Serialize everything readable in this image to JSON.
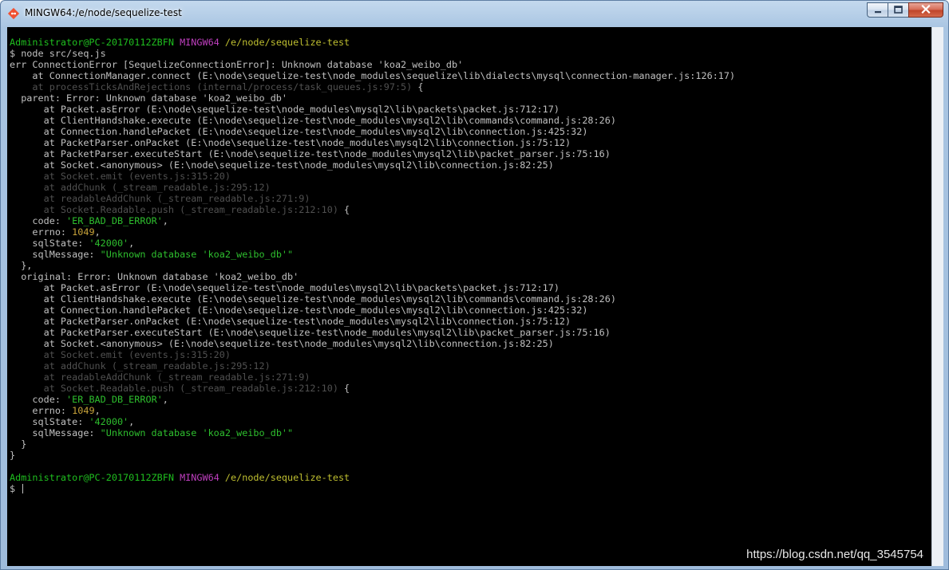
{
  "window": {
    "title": "MINGW64:/e/node/sequelize-test"
  },
  "colors": {
    "default": "#c0c0c0",
    "user": "#1fbf1f",
    "host": "#bf3fbf",
    "path": "#bfbf30",
    "dim": "#505050",
    "string": "#2ebf2e",
    "number": "#c8a33a",
    "cursor": "#c0c0c0"
  },
  "icons": {
    "app": "git-diamond-icon",
    "minimize": "minimize-icon",
    "maximize": "maximize-icon",
    "close": "close-icon"
  },
  "terminal": {
    "lines": [
      [
        {
          "t": "Administrator@PC-20170112ZBFN",
          "c": "user"
        },
        {
          "t": " "
        },
        {
          "t": "MINGW64",
          "c": "host"
        },
        {
          "t": " "
        },
        {
          "t": "/e/node/sequelize-test",
          "c": "path"
        }
      ],
      [
        {
          "t": "$ node src/seq.js"
        }
      ],
      [
        {
          "t": "err ConnectionError [SequelizeConnectionError]: Unknown database 'koa2_weibo_db'"
        }
      ],
      [
        {
          "t": "    at ConnectionManager.connect (E:\\node\\sequelize-test\\node_modules\\sequelize\\lib\\dialects\\mysql\\connection-manager.js:126:17)"
        }
      ],
      [
        {
          "t": "    at processTicksAndRejections (internal/process/task_queues.js:97:5)",
          "c": "dim"
        },
        {
          "t": " {"
        }
      ],
      [
        {
          "t": "  parent: Error: Unknown database 'koa2_weibo_db'"
        }
      ],
      [
        {
          "t": "      at Packet.asError (E:\\node\\sequelize-test\\node_modules\\mysql2\\lib\\packets\\packet.js:712:17)"
        }
      ],
      [
        {
          "t": "      at ClientHandshake.execute (E:\\node\\sequelize-test\\node_modules\\mysql2\\lib\\commands\\command.js:28:26)"
        }
      ],
      [
        {
          "t": "      at Connection.handlePacket (E:\\node\\sequelize-test\\node_modules\\mysql2\\lib\\connection.js:425:32)"
        }
      ],
      [
        {
          "t": "      at PacketParser.onPacket (E:\\node\\sequelize-test\\node_modules\\mysql2\\lib\\connection.js:75:12)"
        }
      ],
      [
        {
          "t": "      at PacketParser.executeStart (E:\\node\\sequelize-test\\node_modules\\mysql2\\lib\\packet_parser.js:75:16)"
        }
      ],
      [
        {
          "t": "      at Socket.<anonymous> (E:\\node\\sequelize-test\\node_modules\\mysql2\\lib\\connection.js:82:25)"
        }
      ],
      [
        {
          "t": "      at Socket.emit (events.js:315:20)",
          "c": "dim"
        }
      ],
      [
        {
          "t": "      at addChunk (_stream_readable.js:295:12)",
          "c": "dim"
        }
      ],
      [
        {
          "t": "      at readableAddChunk (_stream_readable.js:271:9)",
          "c": "dim"
        }
      ],
      [
        {
          "t": "      at Socket.Readable.push (_stream_readable.js:212:10)",
          "c": "dim"
        },
        {
          "t": " {"
        }
      ],
      [
        {
          "t": "    code: "
        },
        {
          "t": "'ER_BAD_DB_ERROR'",
          "c": "string"
        },
        {
          "t": ","
        }
      ],
      [
        {
          "t": "    errno: "
        },
        {
          "t": "1049",
          "c": "number"
        },
        {
          "t": ","
        }
      ],
      [
        {
          "t": "    sqlState: "
        },
        {
          "t": "'42000'",
          "c": "string"
        },
        {
          "t": ","
        }
      ],
      [
        {
          "t": "    sqlMessage: "
        },
        {
          "t": "\"Unknown database 'koa2_weibo_db'\"",
          "c": "string"
        }
      ],
      [
        {
          "t": "  },"
        }
      ],
      [
        {
          "t": "  original: Error: Unknown database 'koa2_weibo_db'"
        }
      ],
      [
        {
          "t": "      at Packet.asError (E:\\node\\sequelize-test\\node_modules\\mysql2\\lib\\packets\\packet.js:712:17)"
        }
      ],
      [
        {
          "t": "      at ClientHandshake.execute (E:\\node\\sequelize-test\\node_modules\\mysql2\\lib\\commands\\command.js:28:26)"
        }
      ],
      [
        {
          "t": "      at Connection.handlePacket (E:\\node\\sequelize-test\\node_modules\\mysql2\\lib\\connection.js:425:32)"
        }
      ],
      [
        {
          "t": "      at PacketParser.onPacket (E:\\node\\sequelize-test\\node_modules\\mysql2\\lib\\connection.js:75:12)"
        }
      ],
      [
        {
          "t": "      at PacketParser.executeStart (E:\\node\\sequelize-test\\node_modules\\mysql2\\lib\\packet_parser.js:75:16)"
        }
      ],
      [
        {
          "t": "      at Socket.<anonymous> (E:\\node\\sequelize-test\\node_modules\\mysql2\\lib\\connection.js:82:25)"
        }
      ],
      [
        {
          "t": "      at Socket.emit (events.js:315:20)",
          "c": "dim"
        }
      ],
      [
        {
          "t": "      at addChunk (_stream_readable.js:295:12)",
          "c": "dim"
        }
      ],
      [
        {
          "t": "      at readableAddChunk (_stream_readable.js:271:9)",
          "c": "dim"
        }
      ],
      [
        {
          "t": "      at Socket.Readable.push (_stream_readable.js:212:10)",
          "c": "dim"
        },
        {
          "t": " {"
        }
      ],
      [
        {
          "t": "    code: "
        },
        {
          "t": "'ER_BAD_DB_ERROR'",
          "c": "string"
        },
        {
          "t": ","
        }
      ],
      [
        {
          "t": "    errno: "
        },
        {
          "t": "1049",
          "c": "number"
        },
        {
          "t": ","
        }
      ],
      [
        {
          "t": "    sqlState: "
        },
        {
          "t": "'42000'",
          "c": "string"
        },
        {
          "t": ","
        }
      ],
      [
        {
          "t": "    sqlMessage: "
        },
        {
          "t": "\"Unknown database 'koa2_weibo_db'\"",
          "c": "string"
        }
      ],
      [
        {
          "t": "  }"
        }
      ],
      [
        {
          "t": "}"
        }
      ],
      [
        {
          "t": ""
        }
      ],
      [
        {
          "t": "Administrator@PC-20170112ZBFN",
          "c": "user"
        },
        {
          "t": " "
        },
        {
          "t": "MINGW64",
          "c": "host"
        },
        {
          "t": " "
        },
        {
          "t": "/e/node/sequelize-test",
          "c": "path"
        }
      ],
      [
        {
          "t": "$ "
        }
      ]
    ]
  },
  "watermark": "https://blog.csdn.net/qq_3545754"
}
